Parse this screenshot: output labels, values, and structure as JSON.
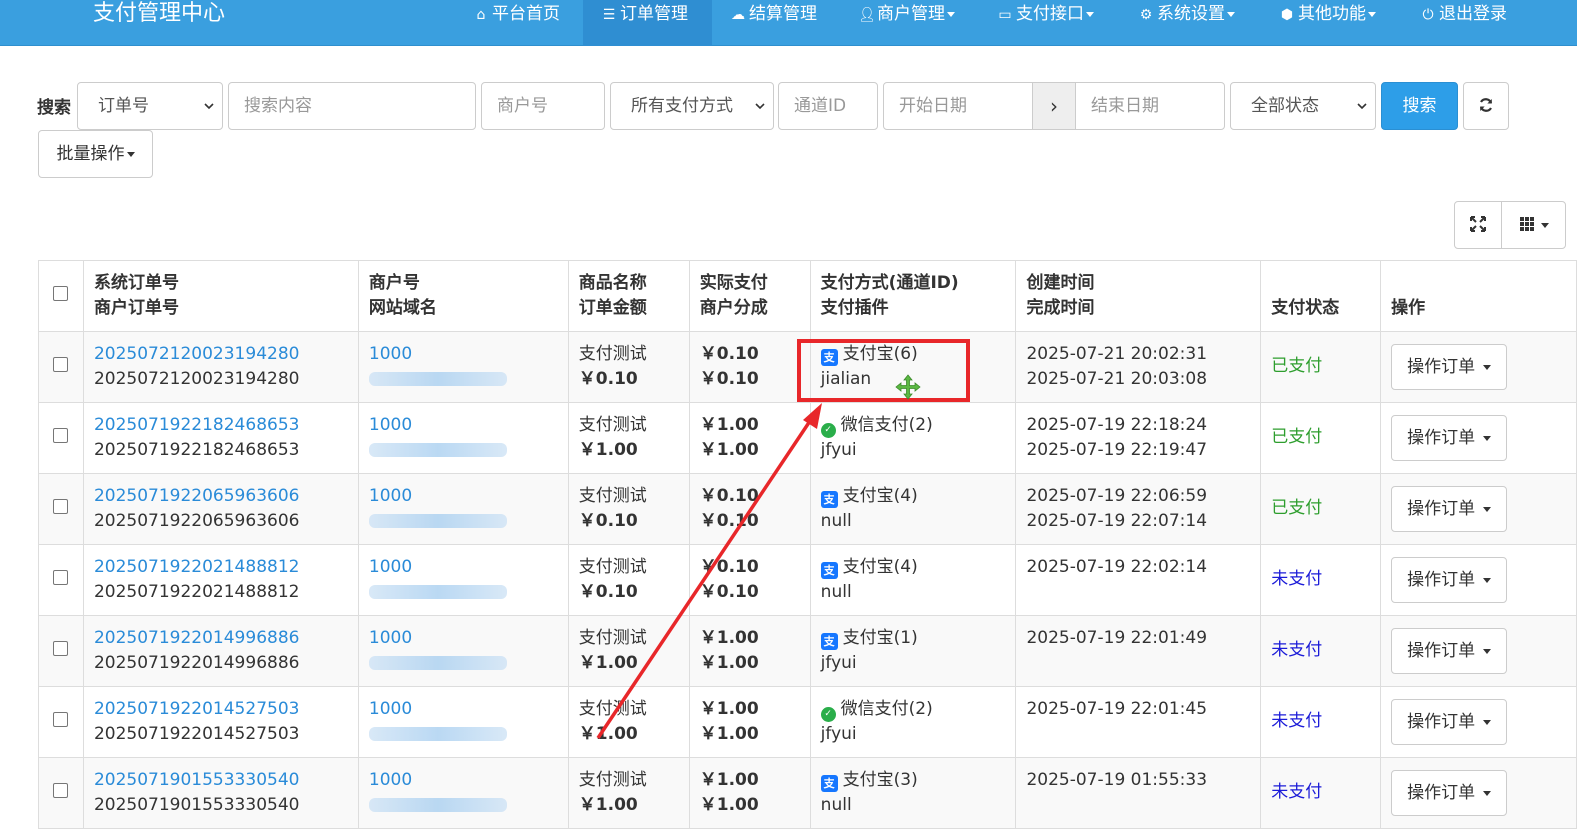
{
  "navbar": {
    "brand": "支付管理中心",
    "items": [
      {
        "label": "平台首页",
        "icon": "home-icon",
        "dropdown": false
      },
      {
        "label": "订单管理",
        "icon": "list-icon",
        "dropdown": false,
        "active": true
      },
      {
        "label": "结算管理",
        "icon": "cloud-icon",
        "dropdown": false
      },
      {
        "label": "商户管理",
        "icon": "user-icon",
        "dropdown": true
      },
      {
        "label": "支付接口",
        "icon": "credit-card-icon",
        "dropdown": true
      },
      {
        "label": "系统设置",
        "icon": "gear-icon",
        "dropdown": true
      },
      {
        "label": "其他功能",
        "icon": "cube-icon",
        "dropdown": true
      },
      {
        "label": "退出登录",
        "icon": "power-icon",
        "dropdown": false
      }
    ]
  },
  "search": {
    "label": "搜索",
    "type_select": "订单号",
    "keyword_placeholder": "搜索内容",
    "merchant_placeholder": "商户号",
    "paytype_select": "所有支付方式",
    "channel_placeholder": "通道ID",
    "start_placeholder": "开始日期",
    "range_arrow": "›",
    "end_placeholder": "结束日期",
    "status_select": "全部状态",
    "submit": "搜索",
    "refresh_icon": "refresh-icon",
    "batch": "批量操作"
  },
  "table": {
    "headers": [
      {
        "line1": "系统订单号",
        "line2": "商户订单号"
      },
      {
        "line1": "商户号",
        "line2": "网站域名"
      },
      {
        "line1": "商品名称",
        "line2": "订单金额"
      },
      {
        "line1": "实际支付",
        "line2": "商户分成"
      },
      {
        "line1": "支付方式(通道ID)",
        "line2": "支付插件"
      },
      {
        "line1": "创建时间",
        "line2": "完成时间"
      },
      {
        "line1": "",
        "line2": "支付状态"
      },
      {
        "line1": "",
        "line2": "操作"
      }
    ],
    "rows": [
      {
        "sys_no": "2025072120023194280",
        "mch_no": "2025072120023194280",
        "mch_id": "1000",
        "product": "支付测试",
        "amount": "￥0.10",
        "paid": "￥0.10",
        "share": "￥0.10",
        "pay_type": "支付宝(6)",
        "pay_icon": "alipay",
        "plugin": "jialian",
        "created": "2025-07-21 20:02:31",
        "finished": "2025-07-21 20:03:08",
        "status": "已支付",
        "paid_status": true,
        "action": "操作订单"
      },
      {
        "sys_no": "2025071922182468653",
        "mch_no": "2025071922182468653",
        "mch_id": "1000",
        "product": "支付测试",
        "amount": "￥1.00",
        "paid": "￥1.00",
        "share": "￥1.00",
        "pay_type": "微信支付(2)",
        "pay_icon": "wechat",
        "plugin": "jfyui",
        "created": "2025-07-19 22:18:24",
        "finished": "2025-07-19 22:19:47",
        "status": "已支付",
        "paid_status": true,
        "action": "操作订单"
      },
      {
        "sys_no": "2025071922065963606",
        "mch_no": "2025071922065963606",
        "mch_id": "1000",
        "product": "支付测试",
        "amount": "￥0.10",
        "paid": "￥0.10",
        "share": "￥0.10",
        "pay_type": "支付宝(4)",
        "pay_icon": "alipay",
        "plugin": "null",
        "created": "2025-07-19 22:06:59",
        "finished": "2025-07-19 22:07:14",
        "status": "已支付",
        "paid_status": true,
        "action": "操作订单"
      },
      {
        "sys_no": "2025071922021488812",
        "mch_no": "2025071922021488812",
        "mch_id": "1000",
        "product": "支付测试",
        "amount": "￥0.10",
        "paid": "￥0.10",
        "share": "￥0.10",
        "pay_type": "支付宝(4)",
        "pay_icon": "alipay",
        "plugin": "null",
        "created": "2025-07-19 22:02:14",
        "finished": "",
        "status": "未支付",
        "paid_status": false,
        "action": "操作订单"
      },
      {
        "sys_no": "2025071922014996886",
        "mch_no": "2025071922014996886",
        "mch_id": "1000",
        "product": "支付测试",
        "amount": "￥1.00",
        "paid": "￥1.00",
        "share": "￥1.00",
        "pay_type": "支付宝(1)",
        "pay_icon": "alipay",
        "plugin": "jfyui",
        "created": "2025-07-19 22:01:49",
        "finished": "",
        "status": "未支付",
        "paid_status": false,
        "action": "操作订单"
      },
      {
        "sys_no": "2025071922014527503",
        "mch_no": "2025071922014527503",
        "mch_id": "1000",
        "product": "支付测试",
        "amount": "￥1.00",
        "paid": "￥1.00",
        "share": "￥1.00",
        "pay_type": "微信支付(2)",
        "pay_icon": "wechat",
        "plugin": "jfyui",
        "created": "2025-07-19 22:01:45",
        "finished": "",
        "status": "未支付",
        "paid_status": false,
        "action": "操作订单"
      },
      {
        "sys_no": "2025071901553330540",
        "mch_no": "2025071901553330540",
        "mch_id": "1000",
        "product": "支付测试",
        "amount": "￥1.00",
        "paid": "￥1.00",
        "share": "￥1.00",
        "pay_type": "支付宝(3)",
        "pay_icon": "alipay",
        "plugin": "null",
        "created": "2025-07-19 01:55:33",
        "finished": "",
        "status": "未支付",
        "paid_status": false,
        "action": "操作订单"
      }
    ]
  },
  "colors": {
    "navbar": "#3a9fdf",
    "link": "#2a8bd8",
    "paid": "#2e9e2e",
    "unpaid": "#1b1bd8",
    "annotation": "#e8272a",
    "primary_button": "#2d9ee8"
  }
}
